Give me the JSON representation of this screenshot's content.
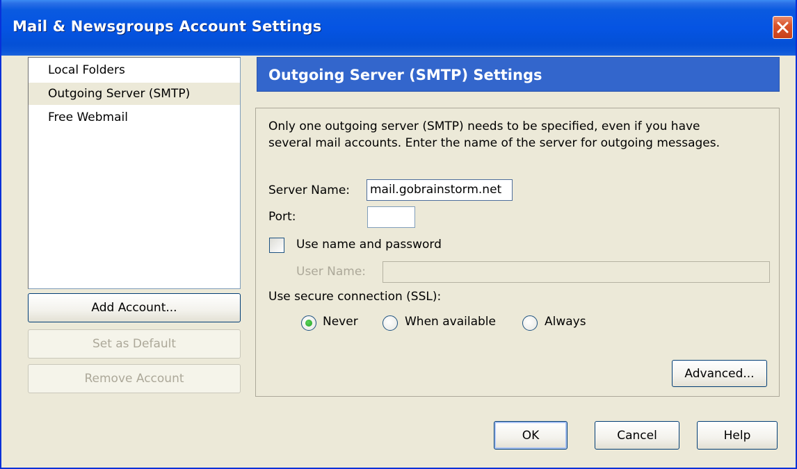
{
  "window": {
    "title": "Mail & Newsgroups Account Settings",
    "colors": {
      "titlebar": "#0554e3",
      "face": "#ece9d8",
      "header": "#3366cc",
      "close": "#d9542c"
    }
  },
  "accounts": {
    "items": [
      {
        "label": "Local Folders"
      },
      {
        "label": "Outgoing Server (SMTP)"
      },
      {
        "label": "Free Webmail"
      }
    ],
    "selected_index": 1
  },
  "account_buttons": {
    "add": "Add Account...",
    "set_default": "Set as Default",
    "remove": "Remove Account"
  },
  "smtp": {
    "header": "Outgoing Server (SMTP) Settings",
    "description_line1": "Only one outgoing server (SMTP) needs to be specified, even if you have",
    "description_line2": "several mail accounts. Enter the name of the server for outgoing messages.",
    "server_name_label": "Server Name:",
    "server_name_value": "mail.gobrainstorm.net",
    "port_label": "Port:",
    "port_value": "",
    "use_auth_label": "Use name and password",
    "use_auth_checked": false,
    "user_name_label": "User Name:",
    "user_name_value": "",
    "ssl_label": "Use secure connection (SSL):",
    "ssl_options": [
      {
        "label": "Never",
        "selected": true
      },
      {
        "label": "When available",
        "selected": false
      },
      {
        "label": "Always",
        "selected": false
      }
    ],
    "advanced_button": "Advanced..."
  },
  "dialog_buttons": {
    "ok": "OK",
    "cancel": "Cancel",
    "help": "Help"
  },
  "icons": [
    "close-icon",
    "radio-selected-icon"
  ]
}
